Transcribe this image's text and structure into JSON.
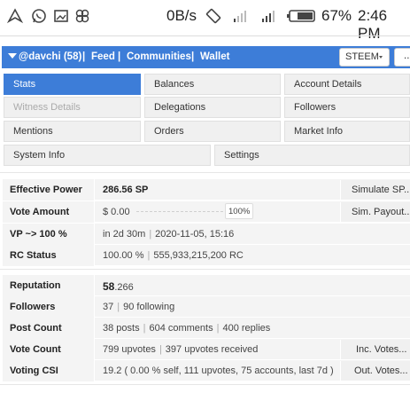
{
  "status_bar": {
    "data_rate": "0B/s",
    "battery": "67%",
    "time": "2:46 PM"
  },
  "nav": {
    "user": "@davchi (58)",
    "links": [
      "Feed",
      "Communities",
      "Wallet"
    ],
    "currency_select": "STEEM",
    "more": "..."
  },
  "tabs": {
    "stats": "Stats",
    "balances": "Balances",
    "account_details": "Account Details",
    "witness_details": "Witness Details",
    "delegations": "Delegations",
    "followers": "Followers",
    "mentions": "Mentions",
    "orders": "Orders",
    "market_info": "Market Info",
    "system_info": "System Info",
    "settings": "Settings"
  },
  "stats": {
    "effective_power": {
      "label": "Effective Power",
      "value": "286.56 SP",
      "button": "Simulate SP..."
    },
    "vote_amount": {
      "label": "Vote Amount",
      "value": "$ 0.00",
      "percent": "100%",
      "button": "Sim. Payout..."
    },
    "vp": {
      "label": "VP ~> 100 %",
      "value1": "in 2d 30m",
      "value2": "2020-11-05, 15:16"
    },
    "rc_status": {
      "label": "RC Status",
      "value1": "100.00 %",
      "value2": "555,933,215,200 RC"
    },
    "reputation": {
      "label": "Reputation",
      "value_main": "58",
      "value_dec": ".266"
    },
    "followers": {
      "label": "Followers",
      "value1": "37",
      "value2": "90 following"
    },
    "post_count": {
      "label": "Post Count",
      "value1": "38 posts",
      "value2": "604 comments",
      "value3": "400 replies"
    },
    "vote_count": {
      "label": "Vote Count",
      "value1": "799 upvotes",
      "value2": "397 upvotes received",
      "button": "Inc. Votes..."
    },
    "voting_csi": {
      "label": "Voting CSI",
      "value": "19.2 ( 0.00 % self, 111 upvotes, 75 accounts, last 7d )",
      "button": "Out. Votes..."
    }
  }
}
